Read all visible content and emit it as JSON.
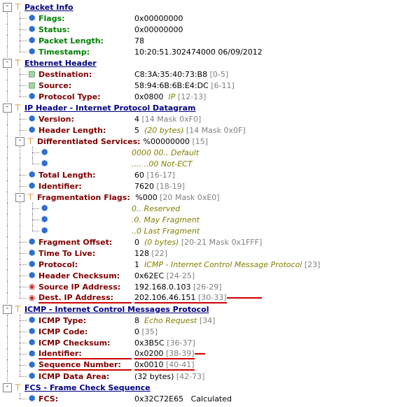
{
  "packetInfo": {
    "heading": "Packet Info",
    "flags": {
      "label": "Flags:",
      "value": "0x00000000"
    },
    "status": {
      "label": "Status:",
      "value": "0x00000000"
    },
    "length": {
      "label": "Packet Length:",
      "value": "78"
    },
    "timestamp": {
      "label": "Timestamp:",
      "value": "10:20:51.302474000 06/09/2012"
    }
  },
  "ethernet": {
    "heading": "Ethernet Header",
    "destination": {
      "label": "Destination:",
      "value": "C8:3A:35:40:73:B8",
      "offset": "[0-5]"
    },
    "source": {
      "label": "Source:",
      "value": "58:94:6B:6B:E4:DC",
      "offset": "[6-11]"
    },
    "protocolType": {
      "label": "Protocol Type:",
      "value": "0x0800",
      "decoded": "IP",
      "offset": "[12-13]"
    }
  },
  "ip": {
    "heading": "IP Header - Internet Protocol Datagram",
    "version": {
      "label": "Version:",
      "value": "4",
      "offset": "[14 Mask 0xF0]"
    },
    "headerLength": {
      "label": "Header Length:",
      "value": "5",
      "decoded": "(20 bytes)",
      "offset": "[14 Mask 0x0F]"
    },
    "diffServ": {
      "label": "Differentiated Services:",
      "value": "%00000000",
      "offset": "[15]",
      "bits": [
        {
          "pattern": "0000 00..",
          "meaning": "Default"
        },
        {
          "pattern": ".... ..00",
          "meaning": "Not-ECT"
        }
      ]
    },
    "totalLength": {
      "label": "Total Length:",
      "value": "60",
      "offset": "[16-17]"
    },
    "identifier": {
      "label": "Identifier:",
      "value": "7620",
      "offset": "[18-19]"
    },
    "fragFlags": {
      "label": "Fragmentation Flags:",
      "value": "%000",
      "offset": "[20 Mask 0xE0]",
      "bits": [
        {
          "pattern": "0..",
          "meaning": "Reserved"
        },
        {
          "pattern": ".0.",
          "meaning": "May Fragment"
        },
        {
          "pattern": "..0",
          "meaning": "Last Fragment"
        }
      ]
    },
    "fragOffset": {
      "label": "Fragment Offset:",
      "value": "0",
      "decoded": "(0 bytes)",
      "offset": "[20-21 Mask 0x1FFF]"
    },
    "ttl": {
      "label": "Time To Live:",
      "value": "128",
      "offset": "[22]"
    },
    "protocol": {
      "label": "Protocol:",
      "value": "1",
      "decoded": "ICMP - Internet Control Message Protocol",
      "offset": "[23]"
    },
    "checksum": {
      "label": "Header Checksum:",
      "value": "0x62EC",
      "offset": "[24-25]"
    },
    "srcIp": {
      "label": "Source IP Address:",
      "value": "192.168.0.103",
      "offset": "[26-29]"
    },
    "dstIp": {
      "label": "Dest. IP Address:",
      "value": "202.106.46.151",
      "offset": "[30-33]"
    }
  },
  "icmp": {
    "heading": "ICMP - Internet Control Messages Protocol",
    "type": {
      "label": "ICMP Type:",
      "value": "8",
      "decoded": "Echo Request",
      "offset": "[34]"
    },
    "code": {
      "label": "ICMP Code:",
      "value": "0",
      "offset": "[35]"
    },
    "checksum": {
      "label": "ICMP Checksum:",
      "value": "0x3B5C",
      "offset": "[36-37]"
    },
    "id": {
      "label": "Identifier:",
      "value": "0x0200",
      "offset": "[38-39]"
    },
    "seq": {
      "label": "Sequence Number:",
      "value": "0x0010",
      "offset": "[40-41]"
    },
    "data": {
      "label": "ICMP Data Area:",
      "value": "(32 bytes)",
      "offset": "[42-73]"
    }
  },
  "fcs": {
    "heading": "FCS - Frame Check Sequence",
    "fcs": {
      "label": "FCS:",
      "value": "0x32C72E65",
      "decoded": "Calculated"
    }
  }
}
